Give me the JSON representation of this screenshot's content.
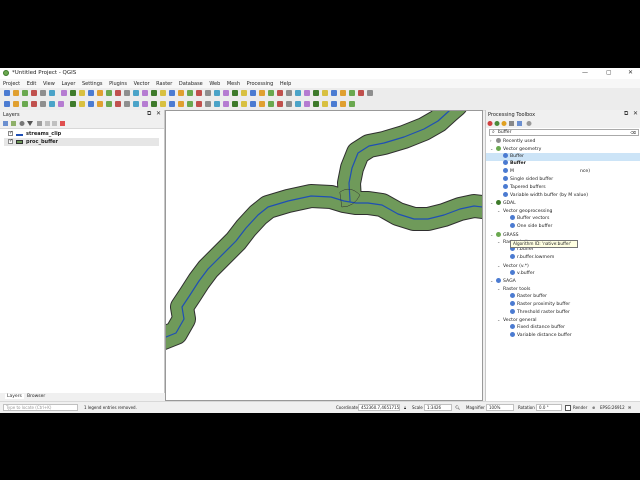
{
  "window": {
    "title": "*Untitled Project - QGIS"
  },
  "menu": [
    "Project",
    "Edit",
    "View",
    "Layer",
    "Settings",
    "Plugins",
    "Vector",
    "Raster",
    "Database",
    "Web",
    "Mesh",
    "Processing",
    "Help"
  ],
  "layers_panel": {
    "title": "Layers",
    "items": [
      {
        "name": "streams_clip",
        "checked": true,
        "symbol": "line",
        "color": "#1f4fb5"
      },
      {
        "name": "proc_buffer",
        "checked": true,
        "symbol": "fill",
        "color": "#6f9a5a"
      }
    ],
    "tabs": [
      "Layers",
      "Browser"
    ]
  },
  "toolbox": {
    "title": "Processing Toolbox",
    "search_value": "buffer",
    "tooltip": "Algorithm ID: 'native:buffer'",
    "tree": [
      {
        "label": "Recently used",
        "level": 0,
        "arrow": "›",
        "icon": "clock"
      },
      {
        "label": "Vector geometry",
        "level": 0,
        "arrow": "⌄",
        "icon": "qgis"
      },
      {
        "label": "Buffer",
        "level": 1,
        "arrow": "",
        "icon": "algo",
        "selected": true
      },
      {
        "label": "Buffer",
        "level": 1,
        "arrow": "",
        "icon": "algo",
        "bold": true
      },
      {
        "label": "M",
        "suffix": "nce)",
        "level": 1,
        "arrow": "",
        "icon": "algo"
      },
      {
        "label": "Single sided buffer",
        "level": 1,
        "arrow": "",
        "icon": "algo"
      },
      {
        "label": "Tapered buffers",
        "level": 1,
        "arrow": "",
        "icon": "algo"
      },
      {
        "label": "Variable width buffer (by M value)",
        "level": 1,
        "arrow": "",
        "icon": "algo"
      },
      {
        "label": "GDAL",
        "level": 0,
        "arrow": "⌄",
        "icon": "gdal"
      },
      {
        "label": "Vector geoprocessing",
        "level": 1,
        "arrow": "⌄",
        "icon": ""
      },
      {
        "label": "Buffer vectors",
        "level": 2,
        "arrow": "",
        "icon": "tool"
      },
      {
        "label": "One side buffer",
        "level": 2,
        "arrow": "",
        "icon": "tool"
      },
      {
        "label": "GRASS",
        "level": 0,
        "arrow": "⌄",
        "icon": "grass"
      },
      {
        "label": "Raster (r.*)",
        "level": 1,
        "arrow": "⌄",
        "icon": ""
      },
      {
        "label": "r.buffer",
        "level": 2,
        "arrow": "",
        "icon": "tool"
      },
      {
        "label": "r.buffer.lowmem",
        "level": 2,
        "arrow": "",
        "icon": "tool"
      },
      {
        "label": "Vector (v.*)",
        "level": 1,
        "arrow": "⌄",
        "icon": ""
      },
      {
        "label": "v.buffer",
        "level": 2,
        "arrow": "",
        "icon": "tool"
      },
      {
        "label": "SAGA",
        "level": 0,
        "arrow": "⌄",
        "icon": "saga"
      },
      {
        "label": "Raster tools",
        "level": 1,
        "arrow": "⌄",
        "icon": ""
      },
      {
        "label": "Raster buffer",
        "level": 2,
        "arrow": "",
        "icon": "saga"
      },
      {
        "label": "Raster proximity buffer",
        "level": 2,
        "arrow": "",
        "icon": "saga"
      },
      {
        "label": "Threshold raster buffer",
        "level": 2,
        "arrow": "",
        "icon": "saga"
      },
      {
        "label": "Vector general",
        "level": 1,
        "arrow": "⌄",
        "icon": ""
      },
      {
        "label": "Fixed distance buffer",
        "level": 2,
        "arrow": "",
        "icon": "saga"
      },
      {
        "label": "Variable distance buffer",
        "level": 2,
        "arrow": "",
        "icon": "saga"
      }
    ]
  },
  "statusbar": {
    "locate_placeholder": "Type to locate (Ctrl+K)",
    "message": "1 legend entries removed.",
    "coordinate_label": "Coordinate",
    "coordinate_value": "452360.7,4651715.5",
    "scale_label": "Scale",
    "scale_value": "1:3426",
    "magnifier_label": "Magnifier",
    "magnifier_value": "100%",
    "rotation_label": "Rotation",
    "rotation_value": "0.0 °",
    "render_label": "Render",
    "crs": "EPSG:26912"
  },
  "colors": {
    "buffer_fill": "#6f9a5a",
    "buffer_stroke": "#2f2f2f",
    "stream": "#1f4fb5",
    "selection": "#cce4f7"
  }
}
